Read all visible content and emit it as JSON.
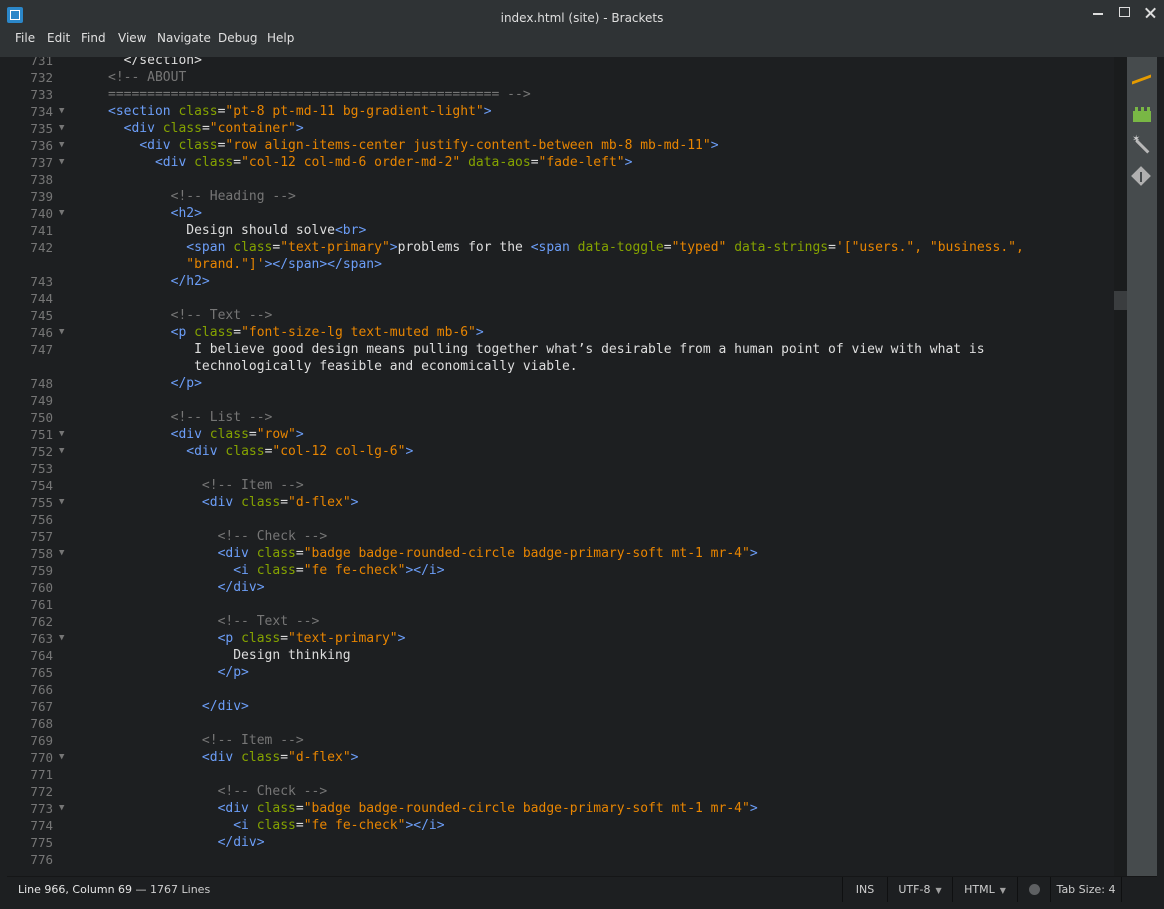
{
  "window": {
    "title": "index.html (site) - Brackets"
  },
  "menu": [
    "File",
    "Edit",
    "Find",
    "View",
    "Navigate",
    "Debug",
    "Help"
  ],
  "editor": {
    "lines": [
      {
        "num": "731",
        "fold": false,
        "tokens": [
          [
            "x",
            "  </section>"
          ]
        ]
      },
      {
        "num": "732",
        "fold": false,
        "tokens": [
          [
            "c",
            "<!-- ABOUT"
          ]
        ]
      },
      {
        "num": "733",
        "fold": false,
        "tokens": [
          [
            "c",
            "================================================== -->"
          ]
        ]
      },
      {
        "num": "734",
        "fold": true,
        "tokens": [
          [
            "t",
            "<section "
          ],
          [
            "a",
            "class"
          ],
          [
            "x",
            "="
          ],
          [
            "s",
            "\"pt-8 pt-md-11 bg-gradient-light\""
          ],
          [
            "t",
            ">"
          ]
        ]
      },
      {
        "num": "735",
        "fold": true,
        "tokens": [
          [
            "x",
            "  "
          ],
          [
            "t",
            "<div "
          ],
          [
            "a",
            "class"
          ],
          [
            "x",
            "="
          ],
          [
            "s",
            "\"container\""
          ],
          [
            "t",
            ">"
          ]
        ]
      },
      {
        "num": "736",
        "fold": true,
        "tokens": [
          [
            "x",
            "    "
          ],
          [
            "t",
            "<div "
          ],
          [
            "a",
            "class"
          ],
          [
            "x",
            "="
          ],
          [
            "s",
            "\"row align-items-center justify-content-between mb-8 mb-md-11\""
          ],
          [
            "t",
            ">"
          ]
        ]
      },
      {
        "num": "737",
        "fold": true,
        "tokens": [
          [
            "x",
            "      "
          ],
          [
            "t",
            "<div "
          ],
          [
            "a",
            "class"
          ],
          [
            "x",
            "="
          ],
          [
            "s",
            "\"col-12 col-md-6 order-md-2\""
          ],
          [
            "x",
            " "
          ],
          [
            "a",
            "data-aos"
          ],
          [
            "x",
            "="
          ],
          [
            "s",
            "\"fade-left\""
          ],
          [
            "t",
            ">"
          ]
        ]
      },
      {
        "num": "738",
        "fold": false,
        "tokens": []
      },
      {
        "num": "739",
        "fold": false,
        "tokens": [
          [
            "x",
            "        "
          ],
          [
            "c",
            "<!-- Heading -->"
          ]
        ]
      },
      {
        "num": "740",
        "fold": true,
        "tokens": [
          [
            "x",
            "        "
          ],
          [
            "t",
            "<h2>"
          ]
        ]
      },
      {
        "num": "741",
        "fold": false,
        "tokens": [
          [
            "x",
            "          Design should solve"
          ],
          [
            "t",
            "<br>"
          ]
        ]
      },
      {
        "num": "742",
        "fold": false,
        "tokens": [
          [
            "x",
            "          "
          ],
          [
            "t",
            "<span "
          ],
          [
            "a",
            "class"
          ],
          [
            "x",
            "="
          ],
          [
            "s",
            "\"text-primary\""
          ],
          [
            "t",
            ">"
          ],
          [
            "x",
            "problems for the "
          ],
          [
            "t",
            "<span "
          ],
          [
            "a",
            "data-toggle"
          ],
          [
            "x",
            "="
          ],
          [
            "s",
            "\"typed\""
          ],
          [
            "x",
            " "
          ],
          [
            "a",
            "data-strings"
          ],
          [
            "x",
            "="
          ],
          [
            "s",
            "'[\"users.\", \"business.\","
          ]
        ]
      },
      {
        "num": "",
        "fold": false,
        "tokens": [
          [
            "x",
            "          "
          ],
          [
            "s",
            "\"brand.\"]'"
          ],
          [
            "t",
            "></span></span>"
          ]
        ]
      },
      {
        "num": "743",
        "fold": false,
        "tokens": [
          [
            "x",
            "        "
          ],
          [
            "t",
            "</h2>"
          ]
        ]
      },
      {
        "num": "744",
        "fold": false,
        "tokens": []
      },
      {
        "num": "745",
        "fold": false,
        "tokens": [
          [
            "x",
            "        "
          ],
          [
            "c",
            "<!-- Text -->"
          ]
        ]
      },
      {
        "num": "746",
        "fold": true,
        "tokens": [
          [
            "x",
            "        "
          ],
          [
            "t",
            "<p "
          ],
          [
            "a",
            "class"
          ],
          [
            "x",
            "="
          ],
          [
            "s",
            "\"font-size-lg text-muted mb-6\""
          ],
          [
            "t",
            ">"
          ]
        ]
      },
      {
        "num": "747",
        "fold": false,
        "tokens": [
          [
            "x",
            "           I believe good design means pulling together what’s desirable from a human point of view with what is"
          ]
        ]
      },
      {
        "num": "",
        "fold": false,
        "tokens": [
          [
            "x",
            "           technologically feasible and economically viable."
          ]
        ]
      },
      {
        "num": "748",
        "fold": false,
        "tokens": [
          [
            "x",
            "        "
          ],
          [
            "t",
            "</p>"
          ]
        ]
      },
      {
        "num": "749",
        "fold": false,
        "tokens": []
      },
      {
        "num": "750",
        "fold": false,
        "tokens": [
          [
            "x",
            "        "
          ],
          [
            "c",
            "<!-- List -->"
          ]
        ]
      },
      {
        "num": "751",
        "fold": true,
        "tokens": [
          [
            "x",
            "        "
          ],
          [
            "t",
            "<div "
          ],
          [
            "a",
            "class"
          ],
          [
            "x",
            "="
          ],
          [
            "s",
            "\"row\""
          ],
          [
            "t",
            ">"
          ]
        ]
      },
      {
        "num": "752",
        "fold": true,
        "tokens": [
          [
            "x",
            "          "
          ],
          [
            "t",
            "<div "
          ],
          [
            "a",
            "class"
          ],
          [
            "x",
            "="
          ],
          [
            "s",
            "\"col-12 col-lg-6\""
          ],
          [
            "t",
            ">"
          ]
        ]
      },
      {
        "num": "753",
        "fold": false,
        "tokens": []
      },
      {
        "num": "754",
        "fold": false,
        "tokens": [
          [
            "x",
            "            "
          ],
          [
            "c",
            "<!-- Item -->"
          ]
        ]
      },
      {
        "num": "755",
        "fold": true,
        "tokens": [
          [
            "x",
            "            "
          ],
          [
            "t",
            "<div "
          ],
          [
            "a",
            "class"
          ],
          [
            "x",
            "="
          ],
          [
            "s",
            "\"d-flex\""
          ],
          [
            "t",
            ">"
          ]
        ]
      },
      {
        "num": "756",
        "fold": false,
        "tokens": []
      },
      {
        "num": "757",
        "fold": false,
        "tokens": [
          [
            "x",
            "              "
          ],
          [
            "c",
            "<!-- Check -->"
          ]
        ]
      },
      {
        "num": "758",
        "fold": true,
        "tokens": [
          [
            "x",
            "              "
          ],
          [
            "t",
            "<div "
          ],
          [
            "a",
            "class"
          ],
          [
            "x",
            "="
          ],
          [
            "s",
            "\"badge badge-rounded-circle badge-primary-soft mt-1 mr-4\""
          ],
          [
            "t",
            ">"
          ]
        ]
      },
      {
        "num": "759",
        "fold": false,
        "tokens": [
          [
            "x",
            "                "
          ],
          [
            "t",
            "<i "
          ],
          [
            "a",
            "class"
          ],
          [
            "x",
            "="
          ],
          [
            "s",
            "\"fe fe-check\""
          ],
          [
            "t",
            "></i>"
          ]
        ]
      },
      {
        "num": "760",
        "fold": false,
        "tokens": [
          [
            "x",
            "              "
          ],
          [
            "t",
            "</div>"
          ]
        ]
      },
      {
        "num": "761",
        "fold": false,
        "tokens": []
      },
      {
        "num": "762",
        "fold": false,
        "tokens": [
          [
            "x",
            "              "
          ],
          [
            "c",
            "<!-- Text -->"
          ]
        ]
      },
      {
        "num": "763",
        "fold": true,
        "tokens": [
          [
            "x",
            "              "
          ],
          [
            "t",
            "<p "
          ],
          [
            "a",
            "class"
          ],
          [
            "x",
            "="
          ],
          [
            "s",
            "\"text-primary\""
          ],
          [
            "t",
            ">"
          ]
        ]
      },
      {
        "num": "764",
        "fold": false,
        "tokens": [
          [
            "x",
            "                Design thinking"
          ]
        ]
      },
      {
        "num": "765",
        "fold": false,
        "tokens": [
          [
            "x",
            "              "
          ],
          [
            "t",
            "</p>"
          ]
        ]
      },
      {
        "num": "766",
        "fold": false,
        "tokens": []
      },
      {
        "num": "767",
        "fold": false,
        "tokens": [
          [
            "x",
            "            "
          ],
          [
            "t",
            "</div>"
          ]
        ]
      },
      {
        "num": "768",
        "fold": false,
        "tokens": []
      },
      {
        "num": "769",
        "fold": false,
        "tokens": [
          [
            "x",
            "            "
          ],
          [
            "c",
            "<!-- Item -->"
          ]
        ]
      },
      {
        "num": "770",
        "fold": true,
        "tokens": [
          [
            "x",
            "            "
          ],
          [
            "t",
            "<div "
          ],
          [
            "a",
            "class"
          ],
          [
            "x",
            "="
          ],
          [
            "s",
            "\"d-flex\""
          ],
          [
            "t",
            ">"
          ]
        ]
      },
      {
        "num": "771",
        "fold": false,
        "tokens": []
      },
      {
        "num": "772",
        "fold": false,
        "tokens": [
          [
            "x",
            "              "
          ],
          [
            "c",
            "<!-- Check -->"
          ]
        ]
      },
      {
        "num": "773",
        "fold": true,
        "tokens": [
          [
            "x",
            "              "
          ],
          [
            "t",
            "<div "
          ],
          [
            "a",
            "class"
          ],
          [
            "x",
            "="
          ],
          [
            "s",
            "\"badge badge-rounded-circle badge-primary-soft mt-1 mr-4\""
          ],
          [
            "t",
            ">"
          ]
        ]
      },
      {
        "num": "774",
        "fold": false,
        "tokens": [
          [
            "x",
            "                "
          ],
          [
            "t",
            "<i "
          ],
          [
            "a",
            "class"
          ],
          [
            "x",
            "="
          ],
          [
            "s",
            "\"fe fe-check\""
          ],
          [
            "t",
            "></i>"
          ]
        ]
      },
      {
        "num": "775",
        "fold": false,
        "tokens": [
          [
            "x",
            "              "
          ],
          [
            "t",
            "</div>"
          ]
        ]
      },
      {
        "num": "776",
        "fold": false,
        "tokens": []
      }
    ]
  },
  "status": {
    "cursor": "Line 966, Column 69",
    "lines": " — 1767 Lines",
    "mode": "INS",
    "encoding": "UTF-8",
    "language": "HTML",
    "tab_label": "Tab Size:",
    "tab_size": "4"
  },
  "icons": {
    "right_toolbar": [
      "live-preview-icon",
      "extension-manager-icon",
      "beautify-icon",
      "git-icon"
    ]
  },
  "colors": {
    "background": "#1d1f21",
    "tag": "#6c9ef8",
    "attribute": "#85a300",
    "string": "#e88501",
    "comment": "#767676",
    "text": "#dedede"
  }
}
